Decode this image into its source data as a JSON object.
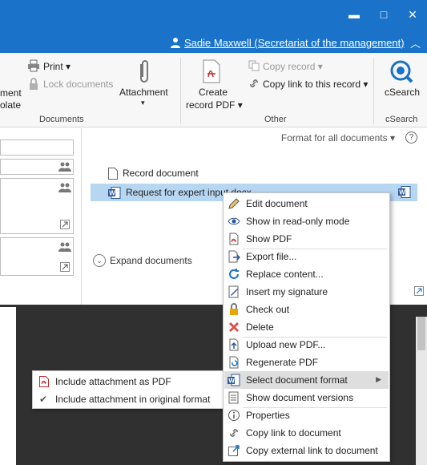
{
  "window": {
    "minimize": "▬",
    "maximize": "□",
    "close": "✕"
  },
  "user": {
    "name": "Sadie Maxwell (Secretariat of the management)"
  },
  "ribbon": {
    "left_cut_1": "ment",
    "left_cut_2": "olate",
    "print": "Print",
    "lock_documents": "Lock documents",
    "attachment": "Attachment",
    "create_record_pdf_line1": "Create",
    "create_record_pdf_line2": "record PDF",
    "copy_record": "Copy record",
    "copy_link_record": "Copy link to this record",
    "csearch": "cSearch",
    "group_documents": "Documents",
    "group_other": "Other",
    "group_csearch": "cSearch"
  },
  "documents": {
    "format_all": "Format for all documents",
    "help": "?",
    "record_document": "Record document",
    "request_doc": "Request for expert input.docx",
    "expand": "Expand documents"
  },
  "attachment_menu": {
    "as_pdf": "Include attachment as PDF",
    "original": "Include attachment in original format"
  },
  "context_menu": [
    {
      "label": "Edit document",
      "icon": "pencil-icon"
    },
    {
      "label": "Show in read-only mode",
      "icon": "eye-icon"
    },
    {
      "label": "Show PDF",
      "icon": "pdf-file-icon"
    },
    {
      "label": "Export file...",
      "icon": "export-icon"
    },
    {
      "label": "Replace content...",
      "icon": "refresh-icon"
    },
    {
      "label": "Insert my signature",
      "icon": "signature-icon"
    },
    {
      "label": "Check out",
      "icon": "lock-icon"
    },
    {
      "label": "Delete",
      "icon": "delete-icon"
    },
    {
      "label": "Upload new PDF...",
      "icon": "upload-icon"
    },
    {
      "label": "Regenerate PDF",
      "icon": "regenerate-pdf-icon"
    },
    {
      "label": "Select document format",
      "icon": "word-icon"
    },
    {
      "label": "Show document versions",
      "icon": "versions-icon"
    },
    {
      "label": "Properties",
      "icon": "info-icon"
    },
    {
      "label": "Copy link to document",
      "icon": "link-icon"
    },
    {
      "label": "Copy external link to document",
      "icon": "external-link-icon"
    }
  ],
  "colors": {
    "titlebar": "#1a73c9",
    "selection": "#b7d6f2",
    "viewer": "#303030",
    "delete": "#d9534f"
  }
}
